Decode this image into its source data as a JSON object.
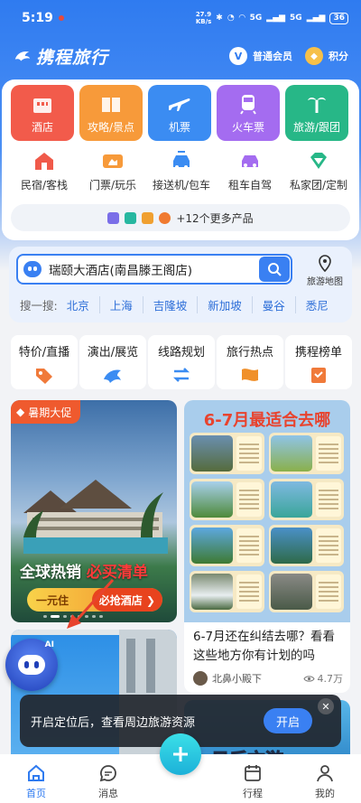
{
  "status": {
    "time": "5:19",
    "net_speed": "27.9\nKB/s",
    "signal1": "5G",
    "signal2": "5G",
    "battery": "36"
  },
  "header": {
    "logo": "携程旅行",
    "member": "普通会员",
    "member_icon": "V",
    "points": "积分"
  },
  "big_tiles": [
    {
      "label": "酒店",
      "color": "#f25b4b"
    },
    {
      "label": "攻略/景点",
      "color": "#f79a3a"
    },
    {
      "label": "机票",
      "color": "#3b8cf2"
    },
    {
      "label": "火车票",
      "color": "#a46cf0"
    },
    {
      "label": "旅游/跟团",
      "color": "#27b787"
    }
  ],
  "small_tiles": [
    {
      "label": "民宿/客栈"
    },
    {
      "label": "门票/玩乐"
    },
    {
      "label": "接送机/包车"
    },
    {
      "label": "租车自驾"
    },
    {
      "label": "私家团/定制"
    }
  ],
  "more_products": "+12个更多产品",
  "search": {
    "value": "瑞颐大酒店(南昌滕王阁店)",
    "map_label": "旅游地图"
  },
  "suggest": {
    "label": "搜一搜:",
    "keywords": [
      "北京",
      "上海",
      "吉隆坡",
      "新加坡",
      "曼谷",
      "悉尼"
    ]
  },
  "tools": [
    {
      "label": "特价/直播"
    },
    {
      "label": "演出/展览"
    },
    {
      "label": "线路规划"
    },
    {
      "label": "旅行热点"
    },
    {
      "label": "携程榜单"
    }
  ],
  "promo": {
    "tag": "暑期大促",
    "line1": "全球热销",
    "line1_red": "必买清单",
    "btn_left": "一元住",
    "btn_right": "必抢酒店 ❯"
  },
  "article": {
    "poster_title": "6-7月最适合去哪",
    "title": "6-7月还在纠结去哪？看看这些地方你有计划的吗",
    "author": "北鼻小殿下",
    "views": "4.7万"
  },
  "ai_bot": {
    "label": "AI"
  },
  "card5": {
    "text": "日后方游"
  },
  "toast": {
    "message": "开启定位后，查看周边旅游资源",
    "action": "开启",
    "close": "✕"
  },
  "tabbar": [
    {
      "label": "首页"
    },
    {
      "label": "消息"
    },
    {
      "label": ""
    },
    {
      "label": "行程"
    },
    {
      "label": "我的"
    }
  ]
}
